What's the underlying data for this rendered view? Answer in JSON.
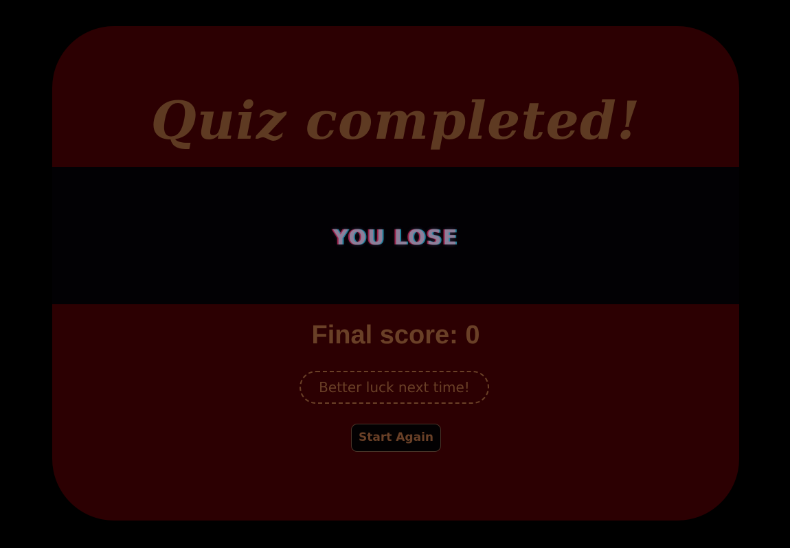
{
  "quiz": {
    "title": "Quiz completed!",
    "result_banner": "YOU LOSE",
    "score_label": "Final score: ",
    "score_value": "0",
    "message": "Better luck next time!",
    "restart_label": "Start Again"
  },
  "colors": {
    "page_background": "#000000",
    "card_background": "#2c0002",
    "banner_background": "#020104",
    "text_brown": "#6a4027",
    "title_brown": "#5e3a22"
  }
}
